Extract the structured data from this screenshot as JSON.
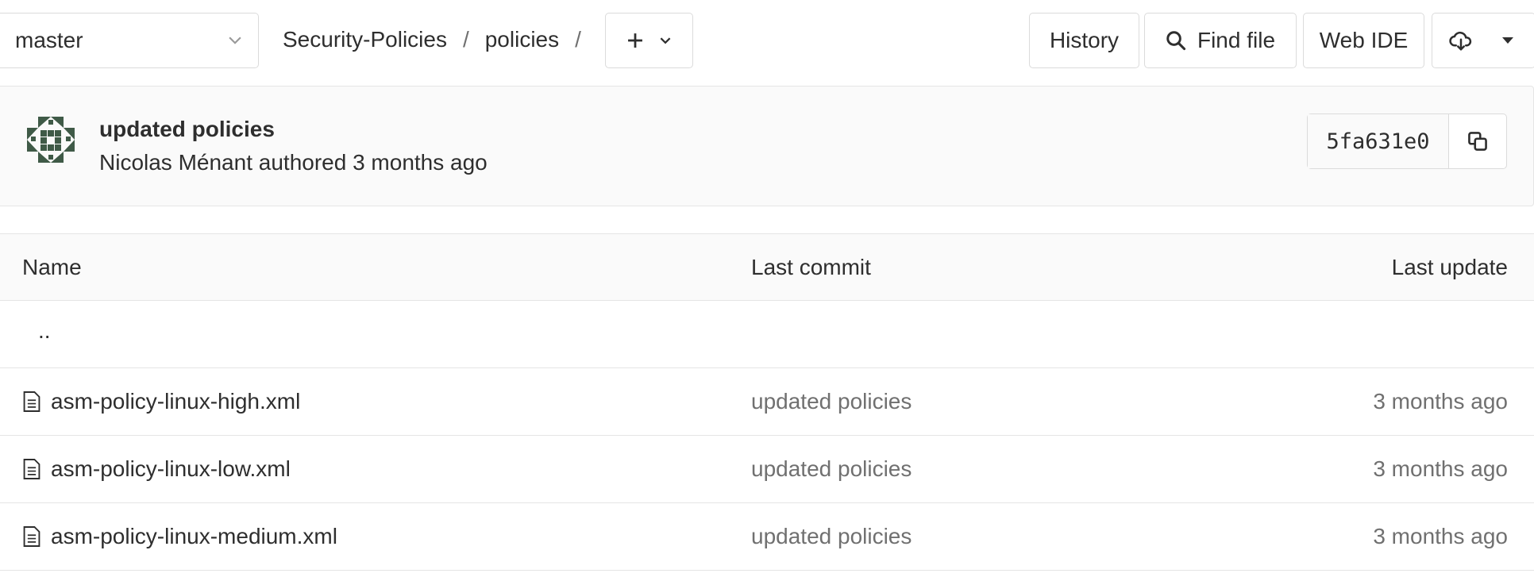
{
  "nav": {
    "branch": "master",
    "breadcrumb": [
      "Security-Policies",
      "policies"
    ],
    "separator": "/",
    "buttons": {
      "history": "History",
      "find_file": "Find file",
      "web_ide": "Web IDE"
    },
    "icons": {
      "add": "plus-icon",
      "dropdown": "chevron-down-icon",
      "search": "search-icon",
      "download": "cloud-download-icon",
      "caret": "caret-down-icon"
    }
  },
  "commit": {
    "title": "updated policies",
    "author": "Nicolas Ménant",
    "meta_suffix": "authored 3 months ago",
    "sha": "5fa631e0",
    "avatar_color": "#3f5a47"
  },
  "table": {
    "headers": {
      "name": "Name",
      "last_commit": "Last commit",
      "last_update": "Last update"
    },
    "parent_dir": "..",
    "files": [
      {
        "name": "asm-policy-linux-high.xml",
        "commit": "updated policies",
        "updated": "3 months ago"
      },
      {
        "name": "asm-policy-linux-low.xml",
        "commit": "updated policies",
        "updated": "3 months ago"
      },
      {
        "name": "asm-policy-linux-medium.xml",
        "commit": "updated policies",
        "updated": "3 months ago"
      }
    ]
  },
  "colors": {
    "text": "#2e2e2e",
    "muted": "#707070",
    "border": "#dbdbdb",
    "panel_bg": "#fafafa"
  }
}
